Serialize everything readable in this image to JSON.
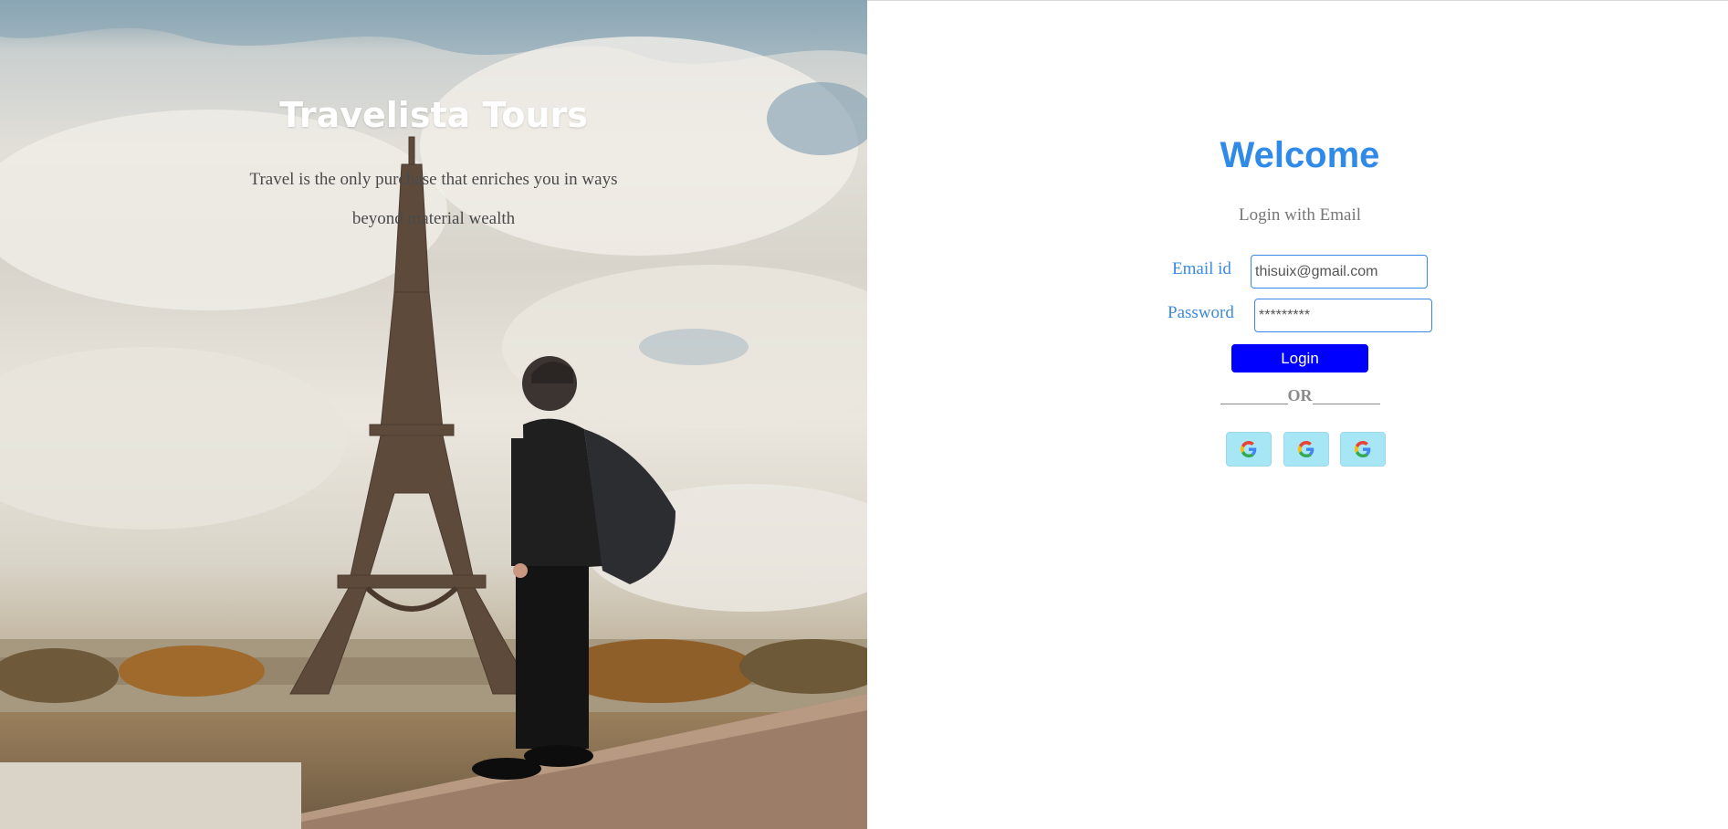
{
  "hero": {
    "title": "Travelista Tours",
    "quote_line1": "Travel is the only purchase that enriches you in ways",
    "quote_line2": "beyond material wealth"
  },
  "login": {
    "title": "Welcome",
    "subtitle": "Login with Email",
    "email_label": "Email id",
    "email_value": "thisuix@gmail.com",
    "password_label": "Password",
    "password_value": "*********",
    "login_label": "Login",
    "or_text": "OR",
    "social_buttons": [
      {
        "icon": "google-icon"
      },
      {
        "icon": "google-icon"
      },
      {
        "icon": "google-icon"
      }
    ]
  },
  "colors": {
    "accent": "#2f8ae8",
    "login_button": "#0000ff",
    "social_button_bg": "#a6e6f5"
  }
}
